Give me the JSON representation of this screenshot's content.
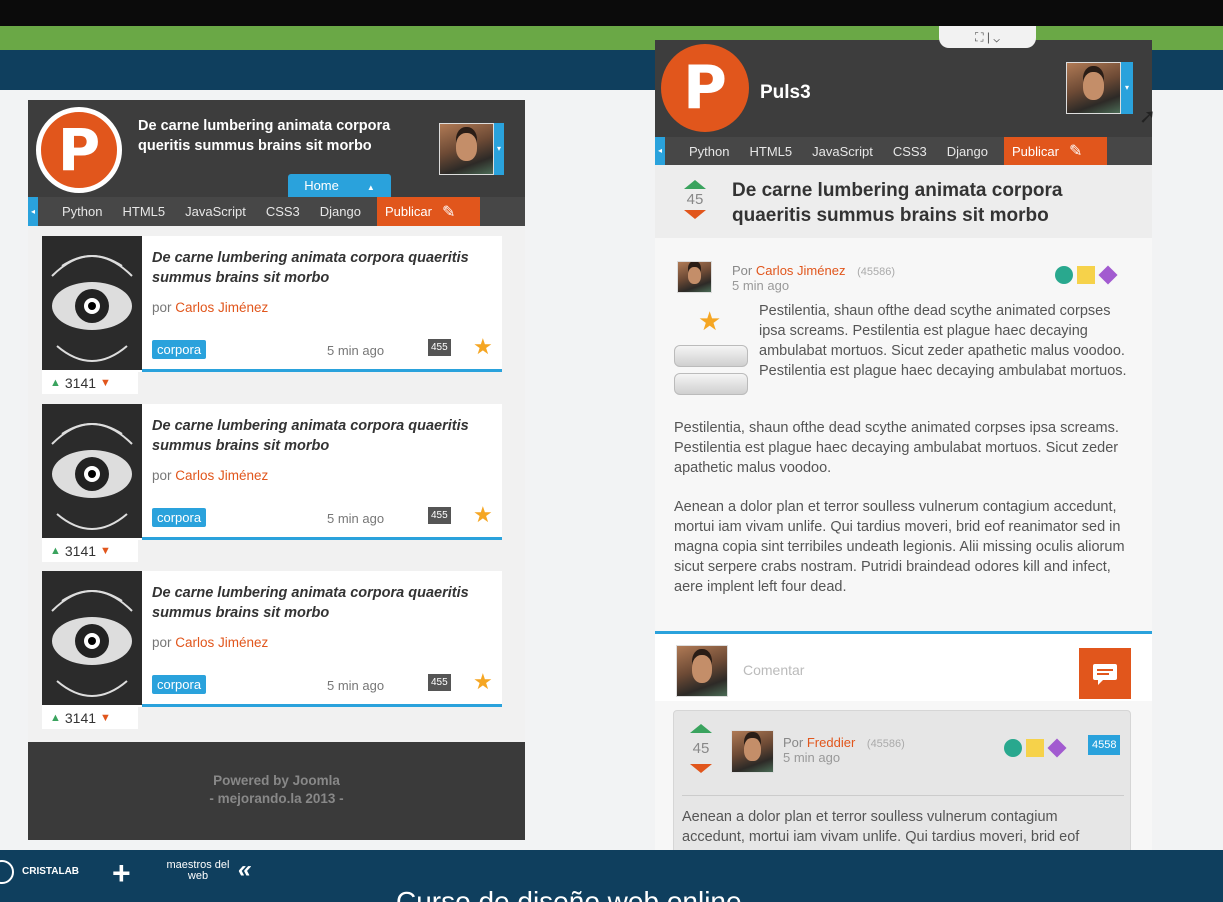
{
  "left": {
    "title": "De carne lumbering animata corpora queritis summus brains sit morbo",
    "home_tab": "Home",
    "nav": [
      "Python",
      "HTML5",
      "JavaScript",
      "CSS3",
      "Django"
    ],
    "publish": "Publicar",
    "cards": [
      {
        "title": "De carne lumbering animata corpora quaeritis summus brains sit morbo",
        "by": "por",
        "author": "Carlos Jiménez",
        "tag": "corpora",
        "time": "5 min ago",
        "count": "455",
        "votes": "3141"
      },
      {
        "title": "De carne lumbering animata corpora quaeritis summus brains sit morbo",
        "by": "por",
        "author": "Carlos Jiménez",
        "tag": "corpora",
        "time": "5 min ago",
        "count": "455",
        "votes": "3141"
      },
      {
        "title": "De carne lumbering animata corpora quaeritis summus brains sit morbo",
        "by": "por",
        "author": "Carlos Jiménez",
        "tag": "corpora",
        "time": "5 min ago",
        "count": "455",
        "votes": "3141"
      }
    ],
    "footer_line1": "Powered by Joomla",
    "footer_line2": "- mejorando.la 2013 -"
  },
  "right": {
    "brand": "Puls3",
    "nav": [
      "Python",
      "HTML5",
      "JavaScript",
      "CSS3",
      "Django"
    ],
    "publish": "Publicar",
    "post_votes": "45",
    "post_title": "De carne lumbering animata corpora quaeritis summus brains sit morbo",
    "by": "Por",
    "author": "Carlos Jiménez",
    "author_id": "(45586)",
    "time": "5 min ago",
    "para1": "Pestilentia, shaun ofthe dead scythe animated corpses ipsa screams. Pestilentia est plague haec decaying ambulabat mortuos. Sicut zeder apathetic malus voodoo. Pestilentia est plague haec decaying ambulabat mortuos.",
    "para2": "Pestilentia, shaun ofthe dead scythe animated corpses ipsa screams. Pestilentia est plague haec decaying ambulabat mortuos. Sicut zeder apathetic malus voodoo.",
    "para3": "Aenean a dolor plan et terror soulless vulnerum contagium accedunt, mortui iam vivam unlife. Qui tardius moveri, brid eof reanimator sed in magna copia sint terribiles undeath legionis. Alii missing oculis aliorum sicut serpere crabs nostram. Putridi braindead odores kill and infect, aere implent left four dead.",
    "comment_placeholder": "Comentar",
    "reply": {
      "votes": "45",
      "by": "Por",
      "author": "Freddier",
      "author_id": "(45586)",
      "time": "5 min ago",
      "badge": "4558",
      "text": "Aenean a dolor plan et terror soulless vulnerum contagium accedunt, mortui iam vivam unlife. Qui tardius moveri, brid eof reanimator sed in magna copia sint terribiles undeath legionis. Alii missing oculis aliorum sicut serpere crabs nos-"
    }
  },
  "bottom": {
    "brand1": "CRISTALAB",
    "brand2": "maestros del web",
    "caption": "Curso de diseño web online"
  },
  "colors": {
    "accent": "#e1561c",
    "blue": "#2aa2dc",
    "green": "#6aa846",
    "navy": "#0f3f5e"
  }
}
